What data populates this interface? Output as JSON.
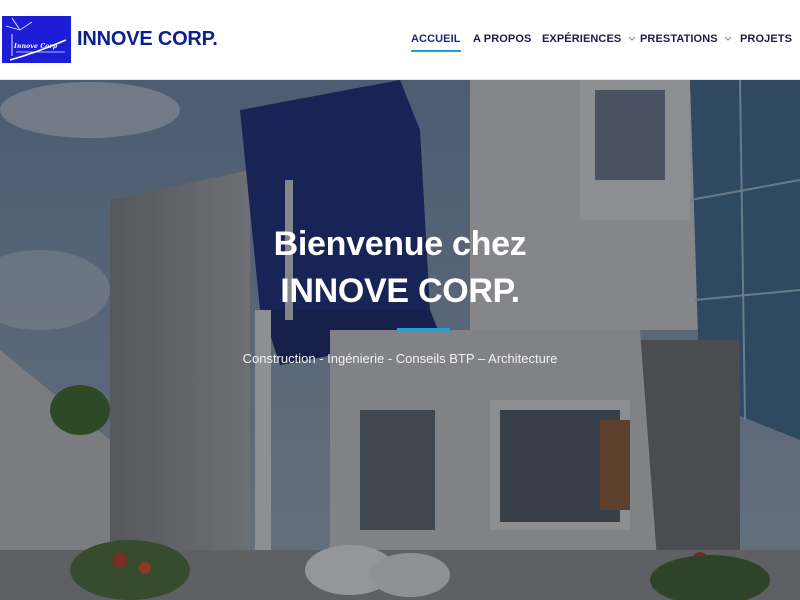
{
  "header": {
    "logo_text": "Innove Corp",
    "brand": "INNOVE CORP."
  },
  "nav": {
    "items": [
      {
        "label": "ACCUEIL",
        "active": true,
        "dropdown": false
      },
      {
        "label": "A PROPOS",
        "active": false,
        "dropdown": false
      },
      {
        "label": "EXPÉRIENCES",
        "active": false,
        "dropdown": true
      },
      {
        "label": "PRESTATIONS",
        "active": false,
        "dropdown": true
      },
      {
        "label": "PROJETS",
        "active": false,
        "dropdown": false
      }
    ]
  },
  "hero": {
    "title_line1": "Bienvenue chez",
    "title_line2": "INNOVE CORP.",
    "subtitle": "Construction - Ingénierie - Conseils BTP – Architecture"
  },
  "colors": {
    "brand_text": "#0b1f8f",
    "logo_bg": "#1d1dd8",
    "accent": "#1ea0d9",
    "nav_text": "#1c1c4a"
  }
}
